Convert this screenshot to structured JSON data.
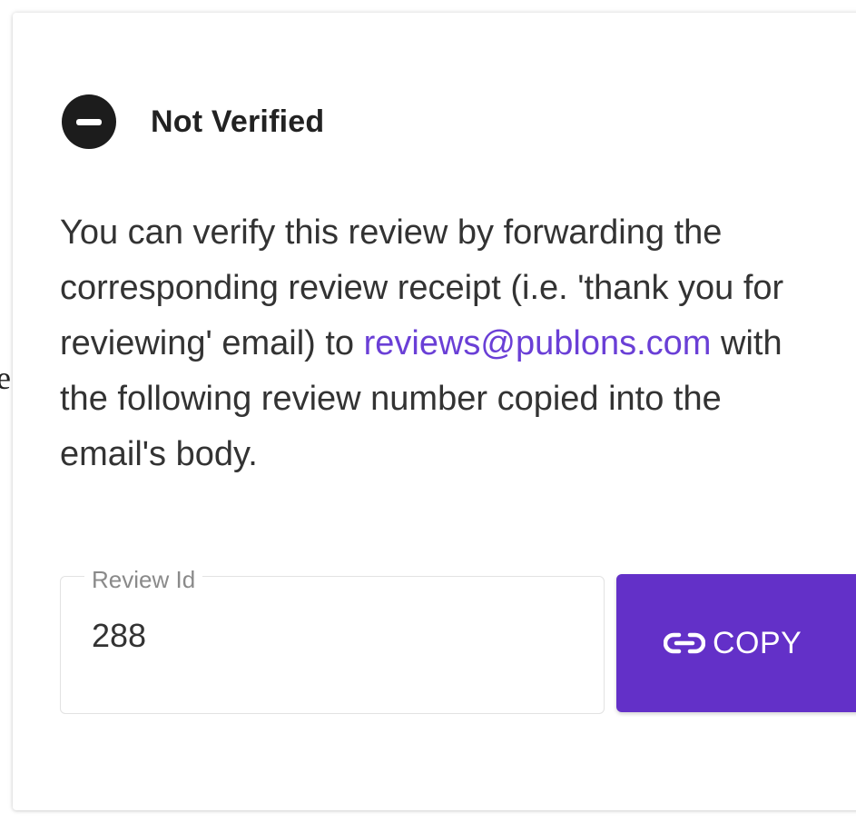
{
  "edge_fragment": "e",
  "status": {
    "icon": "minus-circle-icon",
    "label": "Not Verified"
  },
  "message": {
    "before_link": "You can verify this review by forwarding the corresponding review receipt (i.e. 'thank you for reviewing' email) to ",
    "link_text": "reviews@publons.com",
    "after_link": " with the following review number copied into the email's body."
  },
  "review_field": {
    "label": "Review Id",
    "value": "288"
  },
  "copy_button": {
    "icon": "link-icon",
    "label": "COPY"
  },
  "colors": {
    "accent": "#6330c8",
    "link": "#6a3fd6",
    "status_icon": "#1c1c1c"
  }
}
